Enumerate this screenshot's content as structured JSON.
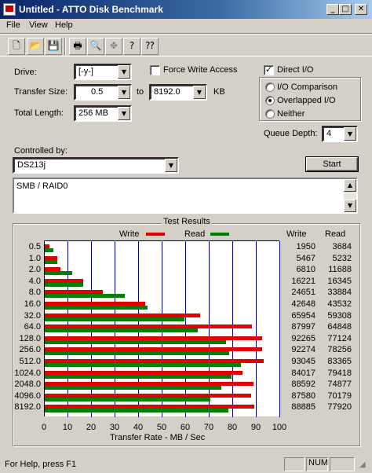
{
  "window": {
    "title": "Untitled - ATTO Disk Benchmark"
  },
  "menu": [
    "File",
    "View",
    "Help"
  ],
  "toolbar_icons": [
    "new-icon",
    "open-icon",
    "save-icon",
    "print-icon",
    "print-preview-icon",
    "move-icon",
    "help-icon",
    "context-help-icon"
  ],
  "drive": {
    "label": "Drive:",
    "value": "[-y-]"
  },
  "transfer_size": {
    "label": "Transfer Size:",
    "from": "0.5",
    "to_label": "to",
    "to": "8192.0",
    "unit": "KB"
  },
  "total_length": {
    "label": "Total Length:",
    "value": "256 MB"
  },
  "force_write": {
    "label": "Force Write Access",
    "checked": false
  },
  "direct_io": {
    "label": "Direct I/O",
    "checked": true
  },
  "io_mode": {
    "options": [
      "I/O Comparison",
      "Overlapped I/O",
      "Neither"
    ],
    "selected": "Overlapped I/O"
  },
  "queue_depth": {
    "label": "Queue Depth:",
    "value": "4"
  },
  "controlled_by": {
    "label": "Controlled by:",
    "value": "DS213j"
  },
  "start_button": "Start",
  "description": "SMB / RAID0",
  "results": {
    "title": "Test Results",
    "legend_write": "Write",
    "legend_read": "Read",
    "col_write": "Write",
    "col_read": "Read",
    "xlabel": "Transfer Rate - MB / Sec",
    "xticks": [
      "0",
      "10",
      "20",
      "30",
      "40",
      "50",
      "60",
      "70",
      "80",
      "90",
      "100"
    ]
  },
  "chart_data": {
    "type": "bar",
    "orientation": "horizontal",
    "categories": [
      "0.5",
      "1.0",
      "2.0",
      "4.0",
      "8.0",
      "16.0",
      "32.0",
      "64.0",
      "128.0",
      "256.0",
      "512.0",
      "1024.0",
      "2048.0",
      "4096.0",
      "8192.0"
    ],
    "series": [
      {
        "name": "Write",
        "color": "#e00000",
        "values": [
          1950,
          5467,
          6810,
          16221,
          24651,
          42648,
          65954,
          87997,
          92265,
          92274,
          93045,
          84017,
          88592,
          87580,
          88885
        ]
      },
      {
        "name": "Read",
        "color": "#008000",
        "values": [
          3684,
          5232,
          11688,
          16345,
          33884,
          43532,
          59308,
          64848,
          77124,
          78256,
          83365,
          79418,
          74877,
          70179,
          77920
        ]
      }
    ],
    "value_unit_divisor": 1000,
    "xlabel": "Transfer Rate - MB / Sec",
    "xlim": [
      0,
      100
    ],
    "grid": true,
    "legend": "top"
  },
  "status": {
    "help": "For Help, press F1",
    "num": "NUM"
  }
}
